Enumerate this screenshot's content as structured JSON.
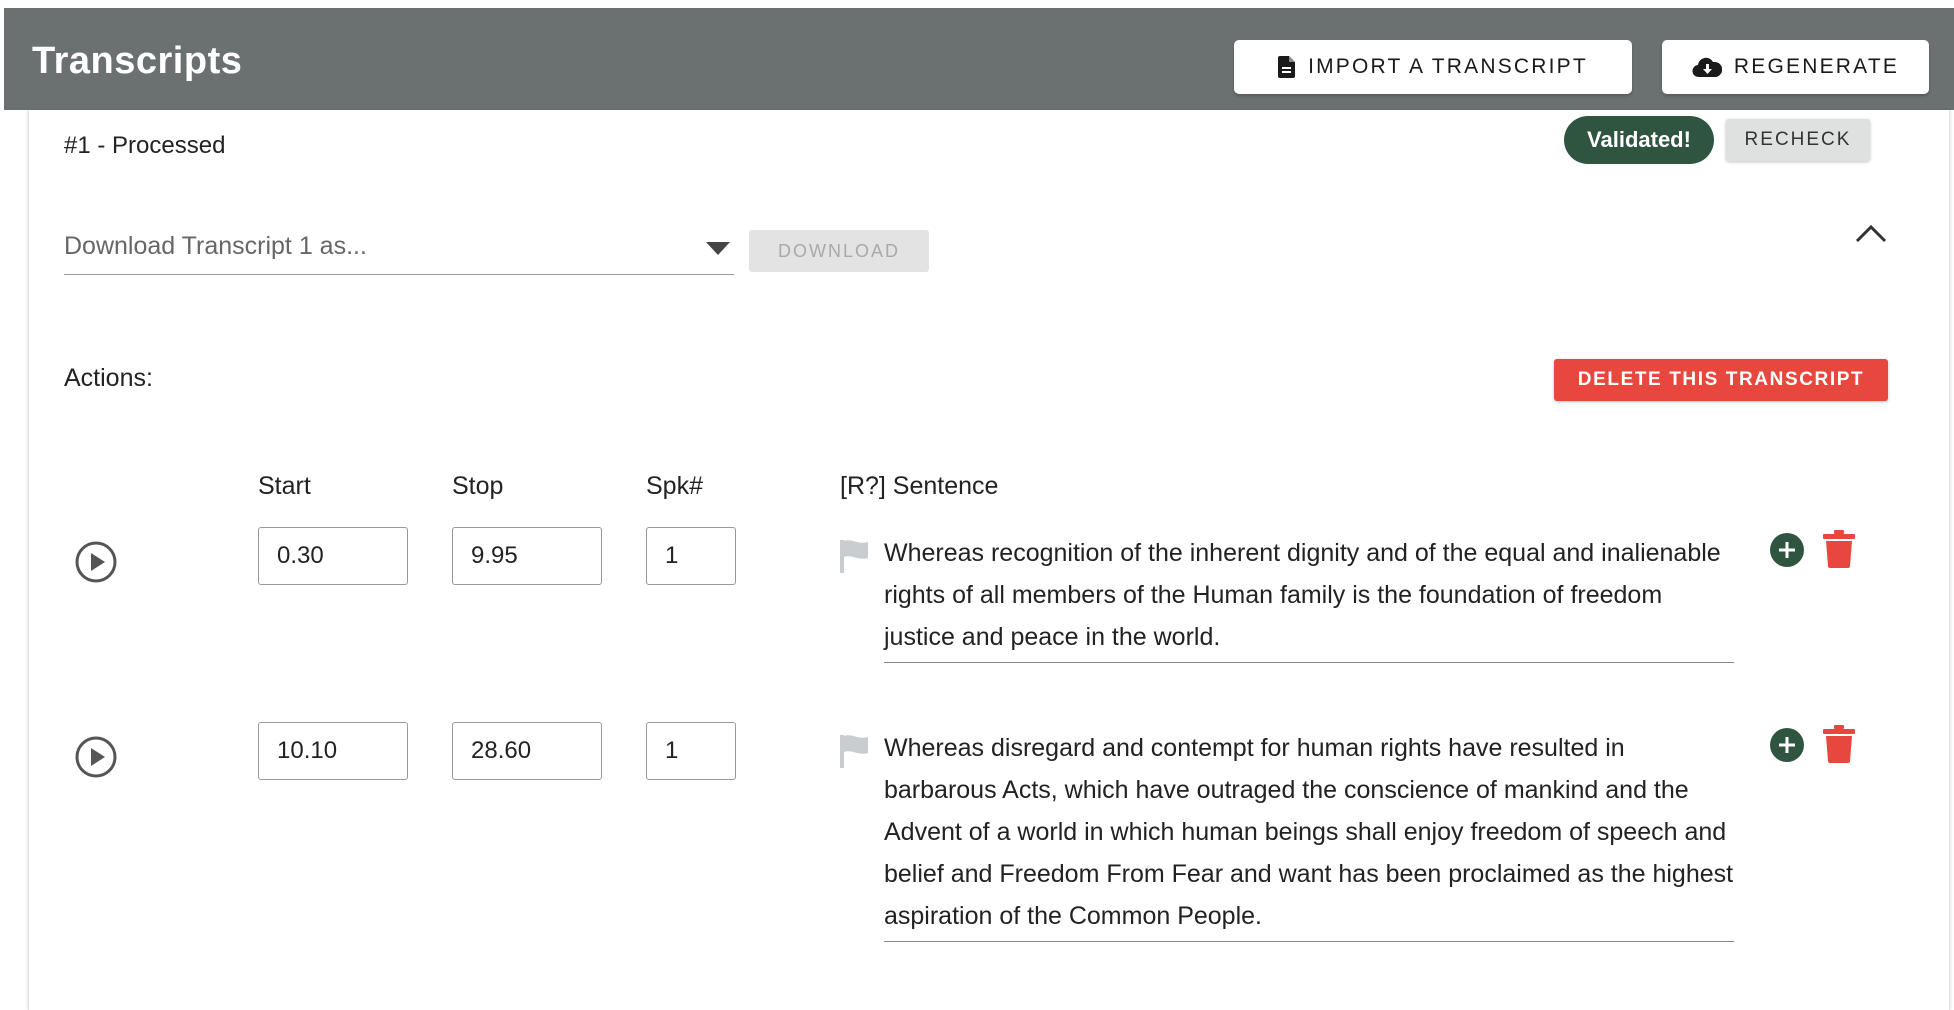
{
  "header": {
    "title": "Transcripts",
    "import_label": "IMPORT A TRANSCRIPT",
    "import_icon": "file-icon",
    "regenerate_label": "REGENERATE",
    "regenerate_icon": "cloud-download-icon"
  },
  "transcript": {
    "heading": "#1 - Processed",
    "status_badge": "Validated!",
    "recheck_label": "RECHECK",
    "download_placeholder": "Download Transcript 1 as...",
    "download_label": "DOWNLOAD",
    "actions_label": "Actions:",
    "delete_label": "DELETE THIS TRANSCRIPT"
  },
  "columns": {
    "start": "Start",
    "stop": "Stop",
    "speaker": "Spk#",
    "sentence": "[R?] Sentence"
  },
  "segments": [
    {
      "start": "0.30",
      "stop": "9.95",
      "speaker": "1",
      "sentence": "Whereas recognition of the inherent dignity and of the equal and inalienable rights of all members of the Human family is the foundation of freedom justice and peace in the world."
    },
    {
      "start": "10.10",
      "stop": "28.60",
      "speaker": "1",
      "sentence": "Whereas disregard and contempt for human rights have resulted in barbarous Acts, which have outraged the conscience of mankind and the Advent of a world in which human beings shall enjoy freedom of speech and belief and Freedom From Fear and want has been proclaimed as the highest aspiration of the Common People."
    }
  ],
  "colors": {
    "header_bg": "#6b7170",
    "validated_bg": "#2f5440",
    "delete_bg": "#e8473e",
    "add_icon": "#2f5440",
    "trash_icon": "#e8473e",
    "flag_icon": "#c9cdcf"
  }
}
